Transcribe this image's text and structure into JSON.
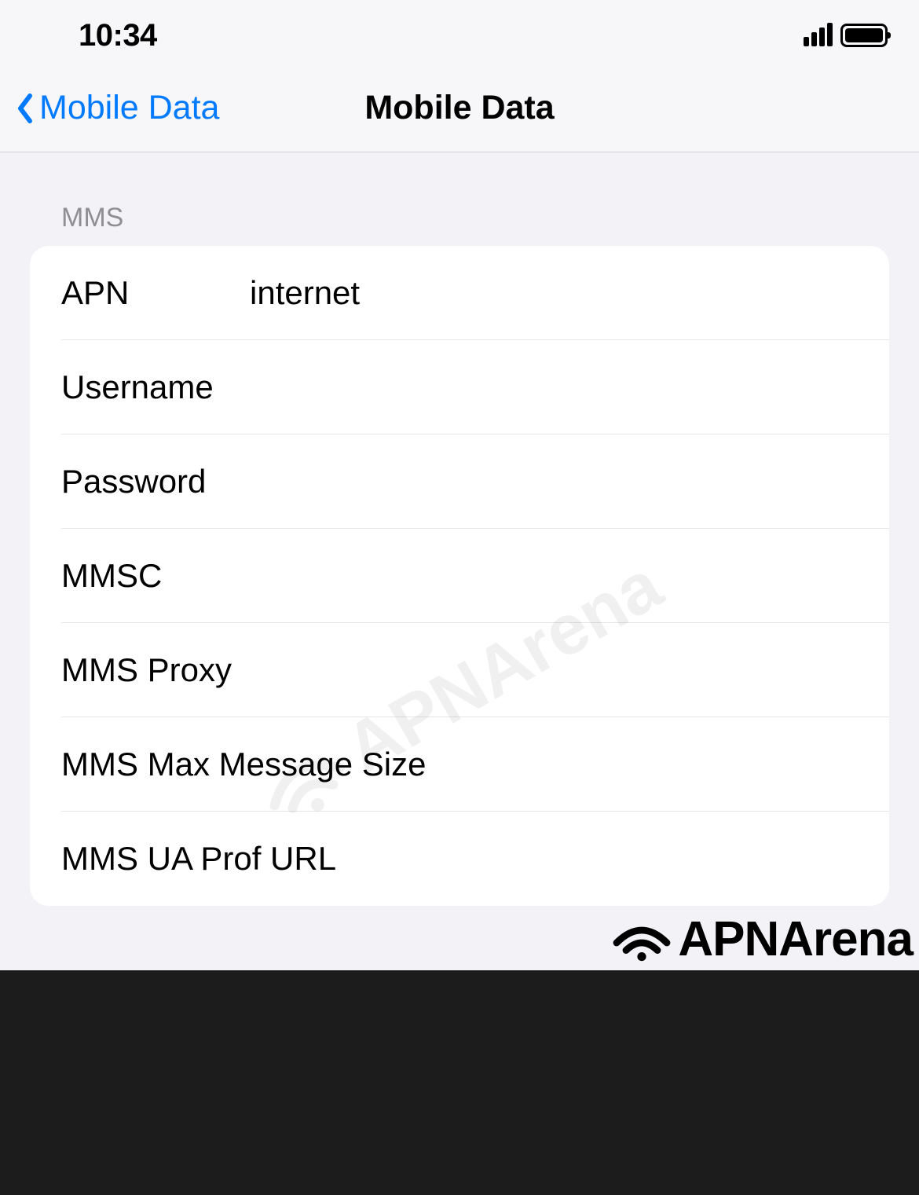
{
  "statusBar": {
    "time": "10:34"
  },
  "nav": {
    "backLabel": "Mobile Data",
    "title": "Mobile Data"
  },
  "section": {
    "header": "MMS"
  },
  "fields": {
    "apn": {
      "label": "APN",
      "value": "internet"
    },
    "username": {
      "label": "Username",
      "value": ""
    },
    "password": {
      "label": "Password",
      "value": ""
    },
    "mmsc": {
      "label": "MMSC",
      "value": ""
    },
    "mmsProxy": {
      "label": "MMS Proxy",
      "value": ""
    },
    "mmsMaxSize": {
      "label": "MMS Max Message Size",
      "value": ""
    },
    "mmsUaProf": {
      "label": "MMS UA Prof URL",
      "value": ""
    }
  },
  "watermark": {
    "centerText": "APNArena",
    "footerText": "APNArena"
  }
}
